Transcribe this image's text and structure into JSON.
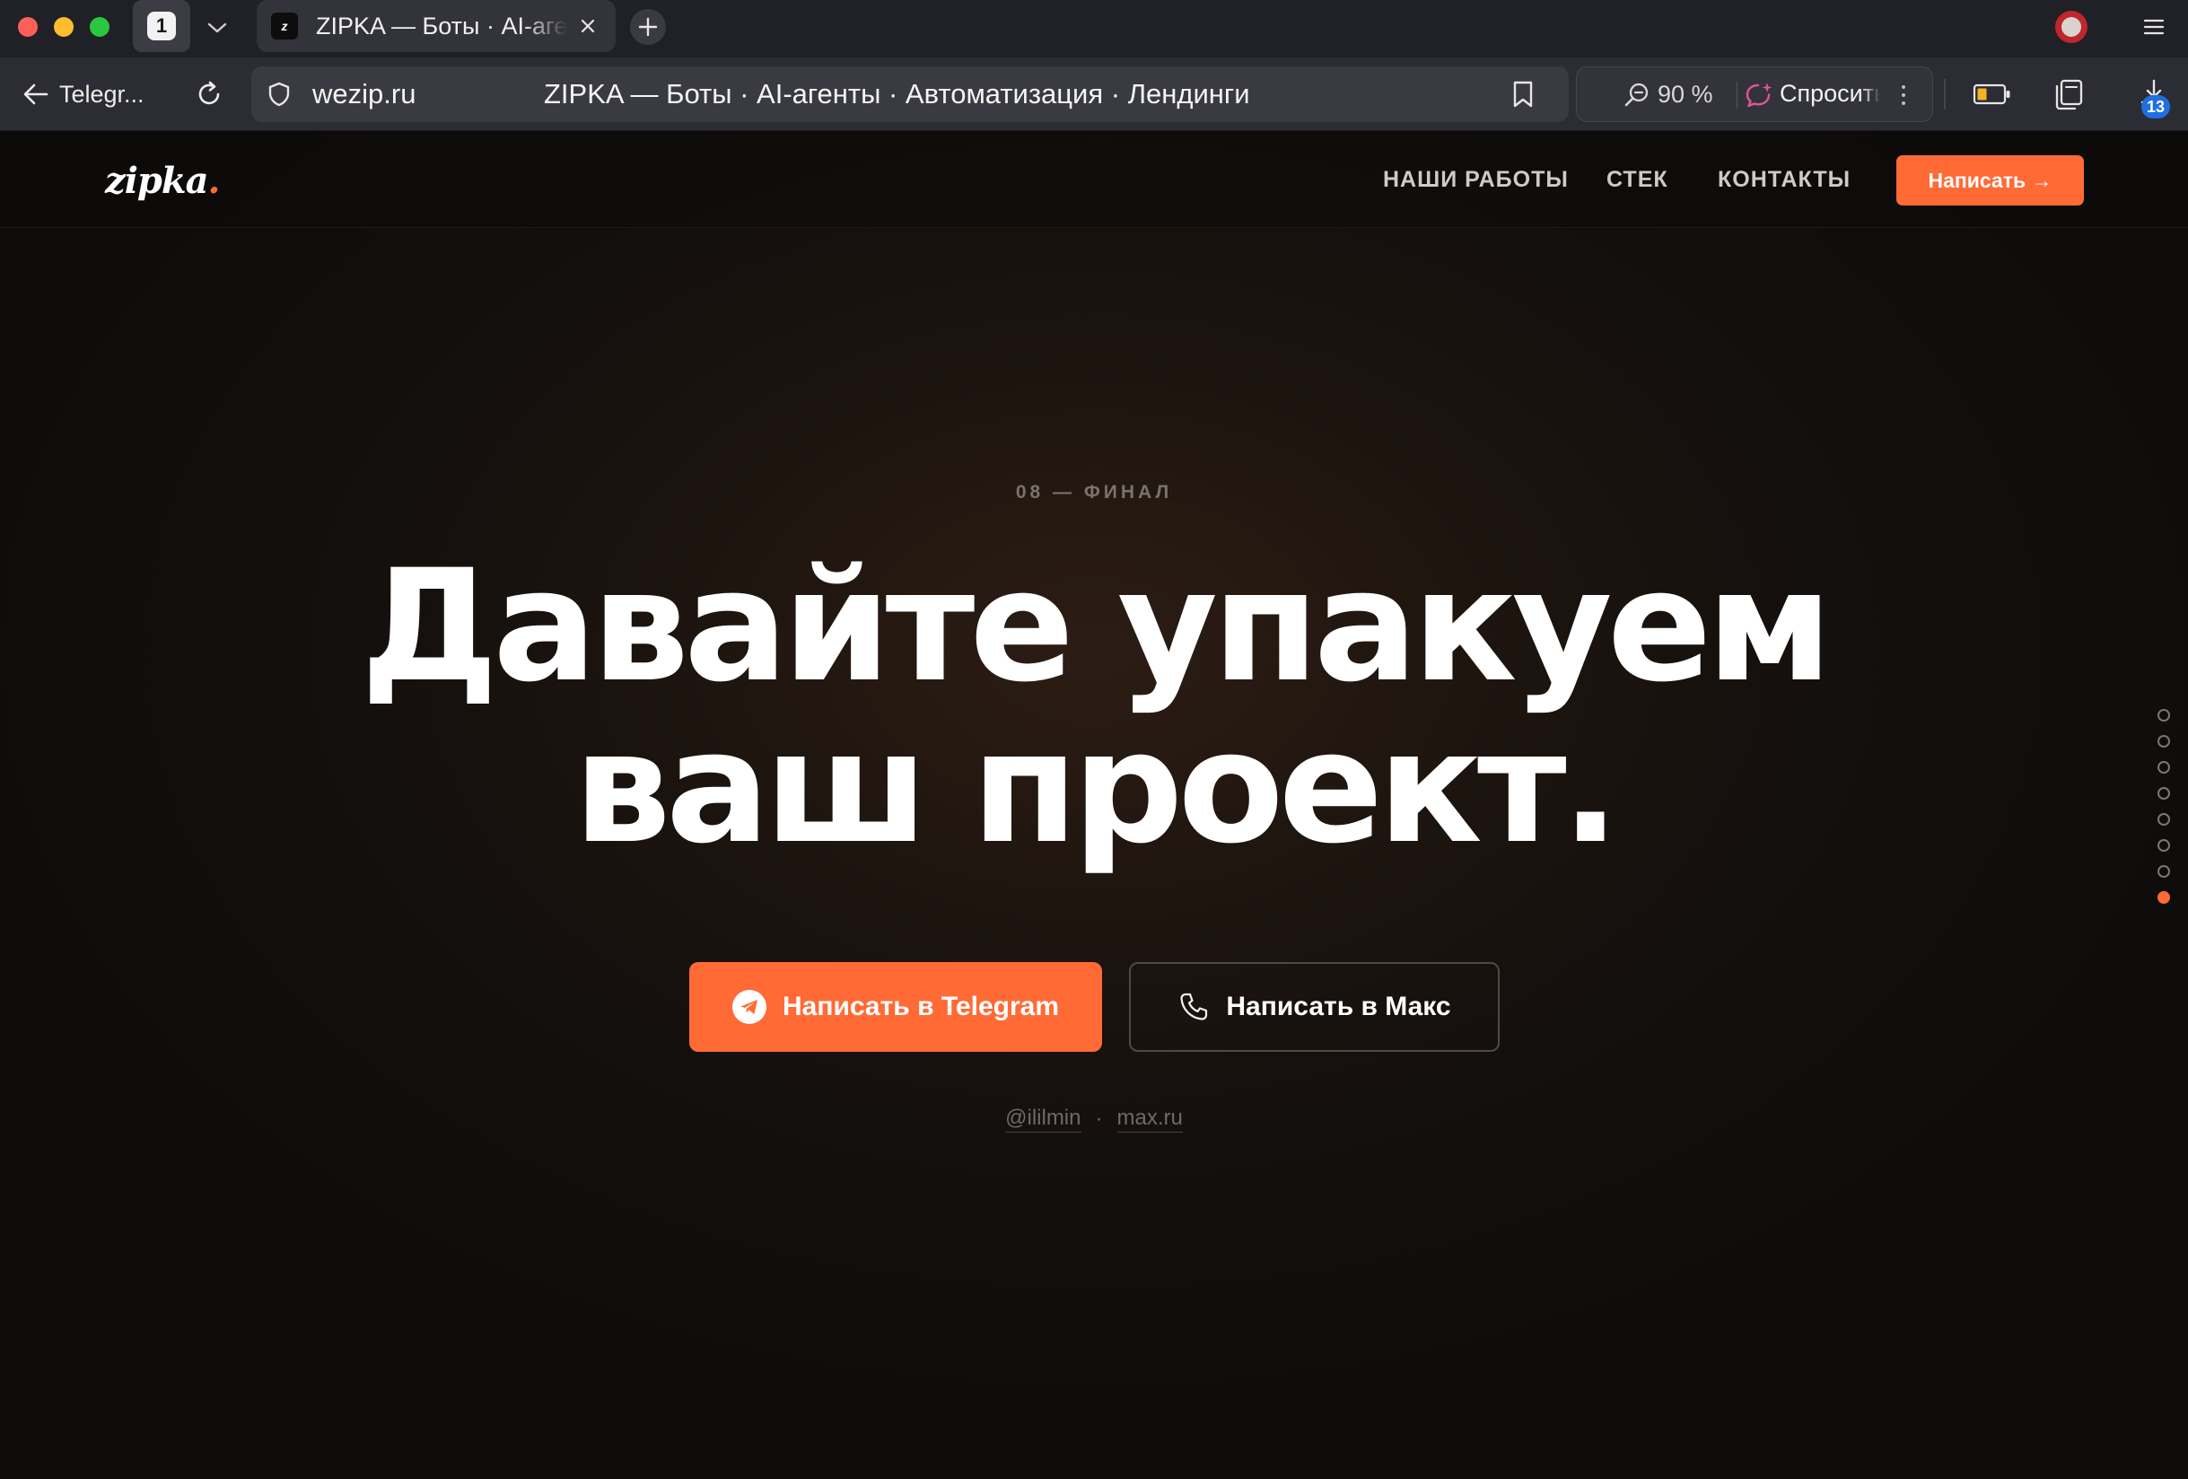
{
  "browser": {
    "tab_count": "1",
    "active_tab_title": "ZIPKA — Боты · AI-агенты · Автоматизация · Лендинги",
    "back_label": "Telegr...",
    "url": "wezip.ru",
    "page_title": "ZIPKA — Боты · AI-агенты · Автоматизация · Лендинги",
    "zoom_level": "90 %",
    "ask_label": "Спросить",
    "downloads_badge": "13",
    "accent_colors": {
      "ask": "#e0559a",
      "downloads_badge": "#1f6fe0"
    }
  },
  "site": {
    "logo": "zipka",
    "logo_dot": ".",
    "nav": {
      "works": "НАШИ РАБОТЫ",
      "stack": "СТЕК",
      "contacts": "КОНТАКТЫ",
      "cta": "Написать →"
    },
    "eyebrow": "08 — ФИНАЛ",
    "headline_line1": "Давайте упакуем",
    "headline_line2": "ваш проект.",
    "cta_telegram": "Написать в Telegram",
    "cta_max": "Написать в Макс",
    "contact_telegram": "@ililmin",
    "contact_separator": "·",
    "contact_max": "max.ru",
    "section_dots": {
      "total": 8,
      "active_index": 7
    },
    "accent_color": "#ff6a35"
  }
}
